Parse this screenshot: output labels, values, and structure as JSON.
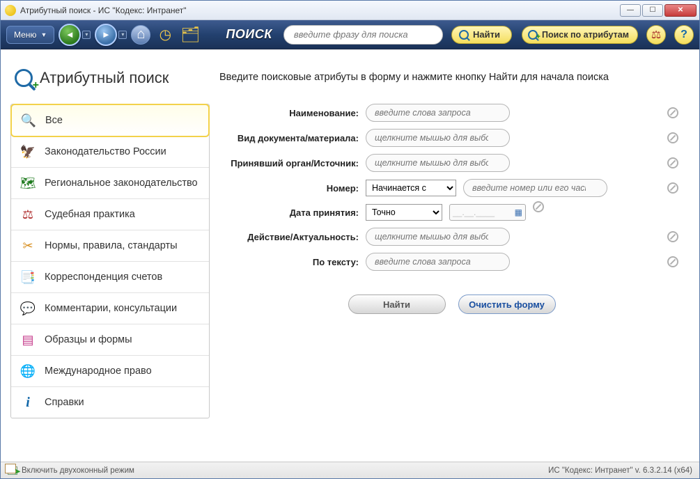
{
  "window": {
    "title": "Атрибутный поиск - ИС \"Кодекс: Интранет\""
  },
  "toolbar": {
    "menu_label": "Меню",
    "search_title": "ПОИСК",
    "search_placeholder": "введите фразу для поиска",
    "find_label": "Найти",
    "attr_label": "Поиск по атрибутам"
  },
  "page": {
    "heading": "Атрибутный поиск",
    "hint": "Введите поисковые атрибуты в форму и нажмите кнопку Найти для начала поиска"
  },
  "sidebar": {
    "items": [
      {
        "label": "Все",
        "icon": "all",
        "active": true
      },
      {
        "label": "Законодательство России",
        "icon": "emblem"
      },
      {
        "label": "Региональное законодательство",
        "icon": "map"
      },
      {
        "label": "Судебная практика",
        "icon": "scale"
      },
      {
        "label": "Нормы, правила, стандарты",
        "icon": "compass"
      },
      {
        "label": "Корреспонденция счетов",
        "icon": "ledger"
      },
      {
        "label": "Комментарии, консультации",
        "icon": "chat"
      },
      {
        "label": "Образцы и формы",
        "icon": "form"
      },
      {
        "label": "Международное право",
        "icon": "globe"
      },
      {
        "label": "Справки",
        "icon": "info"
      }
    ]
  },
  "form": {
    "name_label": "Наименование:",
    "name_placeholder": "введите слова запроса",
    "doctype_label": "Вид документа/материала:",
    "classifier_placeholder": "щелкните мышью для выбора значения из классификатора",
    "authority_label": "Принявший орган/Источник:",
    "number_label": "Номер:",
    "number_mode": "Начинается с",
    "number_placeholder": "введите номер или его часть",
    "date_label": "Дата принятия:",
    "date_mode": "Точно",
    "date_mask": "__.__.____",
    "relevance_label": "Действие/Актуальность:",
    "text_label": "По тексту:",
    "text_placeholder": "введите слова запроса",
    "find_btn": "Найти",
    "clear_btn": "Очистить форму"
  },
  "statusbar": {
    "mode": "Включить двухоконный режим",
    "version": "ИС \"Кодекс: Интранет\" v. 6.3.2.14 (x64)"
  }
}
